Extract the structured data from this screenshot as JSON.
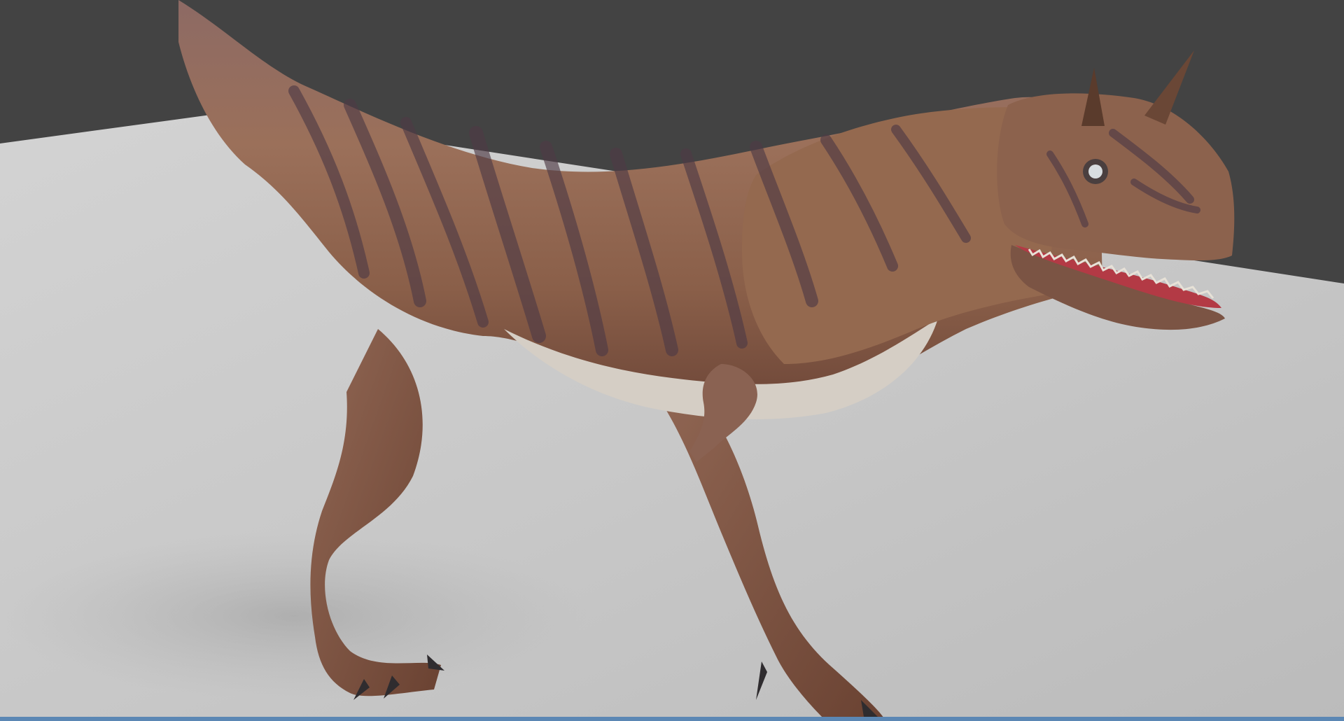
{
  "viewport": {
    "kind": "3d-viewport",
    "background_color": "#434343",
    "floor_color": "#c6c6c6",
    "status_strip_color": "#5b87b4"
  },
  "model": {
    "subject": "carnotaurus-dinosaur",
    "skin_color": "#8f654e",
    "stripe_color": "#4e3a45",
    "belly_color": "#d8d2cb",
    "mouth_color": "#b33a45"
  }
}
